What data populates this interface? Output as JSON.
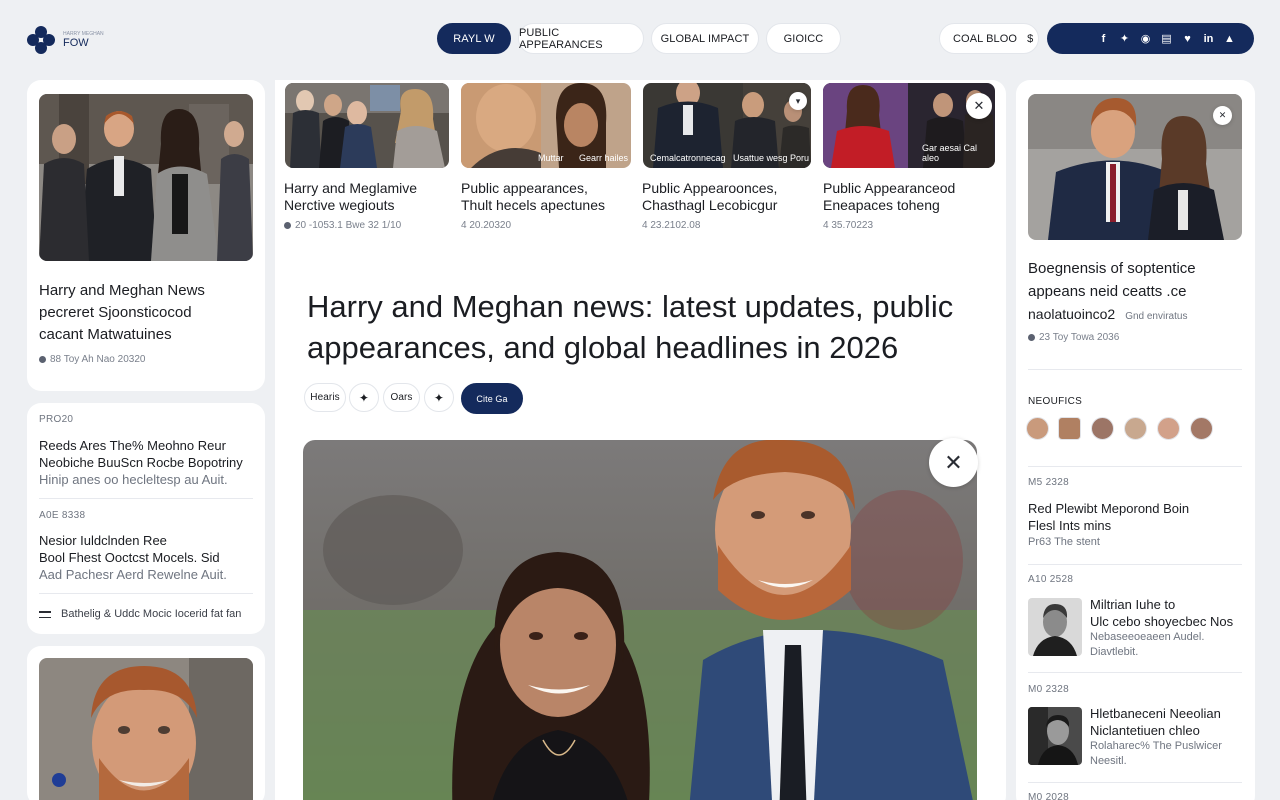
{
  "header": {
    "logo_small": "HARRY MEGHAN",
    "logo_text": "FOW",
    "nav": [
      "RAYL W",
      "PUBLIC APPEARANCES",
      "GLOBAL IMPACT",
      "GIOICC"
    ],
    "search_label": "COAL BLOO",
    "social_icons": [
      "facebook-icon",
      "twitter-icon",
      "instagram-icon",
      "share-icon",
      "pinterest-icon",
      "linkedin-icon",
      "profile-icon"
    ]
  },
  "left": {
    "featured": {
      "headline": [
        "Harry and Meghan News",
        "pecreret Sjoonsticocod",
        "cacant Matwatuines"
      ],
      "meta": "88 Toy Ah Nao 20320"
    },
    "list": {
      "label": "PRO20",
      "items": [
        {
          "lines": [
            "Reeds Ares The% Meohno Reur",
            "Neobiche BuuScn Rocbe Bopotriny",
            "Hinip anes oo hecleltesp au Auit."
          ]
        },
        {
          "date": "A0E 8338",
          "lines": [
            "Nesior Iuldclnden Ree",
            "Bool Fhest Ooctcst Mocels. Sid",
            "Aad Pachesr Aerd Rewelne Auit."
          ]
        }
      ],
      "footer": "Bathelig & Uddc Mocic Iocerid fat fan"
    }
  },
  "top_stories": [
    {
      "title": [
        "Harry and Meglamive",
        "Nerctive wegiouts"
      ],
      "meta": "20 -1053.1 Bwe 32 1/10",
      "captions": []
    },
    {
      "title": [
        "Public appearances,",
        "Thult hecels apectunes"
      ],
      "meta": "4 20.20320",
      "captions": [
        "Muttar",
        "Gearr hailes"
      ]
    },
    {
      "title": [
        "Public Appearoonces,",
        "Chasthagl Lecobicgur"
      ],
      "meta": "4 23.2102.08",
      "captions": [
        "Cemalcatronnecag",
        "Usattue wesg Poru"
      ]
    },
    {
      "title": [
        "Public Appearanceod",
        "Eneapaces toheng"
      ],
      "meta": "4 35.70223",
      "captions": [
        "Gar aesai Cal aleo"
      ]
    }
  ],
  "article": {
    "headline": [
      "Harry and Meghan news: latest updates, public",
      "appearances, and global headlines in 2026"
    ],
    "chips": [
      "Hearis",
      "Oars",
      "Cite Ga"
    ]
  },
  "right": {
    "featured": {
      "headline": [
        "Boegnensis of soptentice",
        "appeans neid ceatts .ce"
      ],
      "sub": [
        "naolatuoinco2",
        "Gnd enviratus"
      ],
      "meta": "23 Toy Towa 2036"
    },
    "avatars_label": "NEOUFICS",
    "items": [
      {
        "date": "M5 2328",
        "lines": [
          "Red Plewibt Meporond Boin",
          "Flesl Ints mins"
        ],
        "sub": [
          "Pr63 The stent"
        ]
      },
      {
        "date": "A10 2528",
        "lines": [
          "Miltrian Iuhe to",
          "Ulc cebo shoyecbec Nos"
        ],
        "sub": [
          "Nebaseeoeaeen Audel.",
          "Diavtlebit."
        ]
      },
      {
        "date": "M0 2328",
        "lines": [
          "Hletbaneceni Neeolian",
          "Niclantetiuen chleo"
        ],
        "sub": [
          "Rolaharec% The Puslwicer",
          "Neesitl."
        ]
      },
      {
        "date": "M0 2028",
        "lines": [],
        "sub": []
      }
    ]
  },
  "colors": {
    "navy": "#142a5c",
    "background": "#eef0f3",
    "card": "#ffffff"
  }
}
